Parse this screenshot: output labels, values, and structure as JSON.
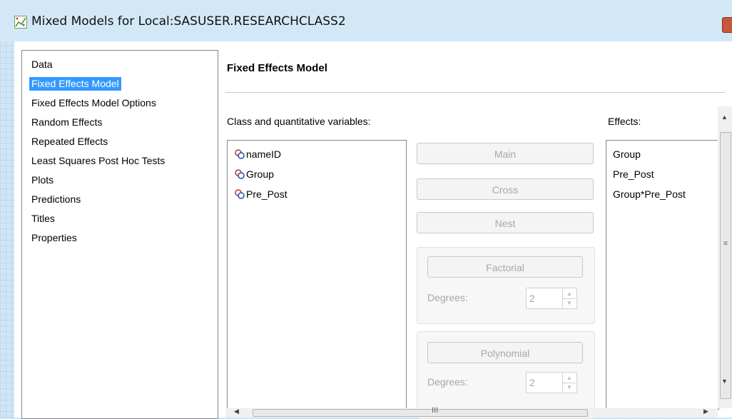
{
  "window": {
    "title": "Mixed Models for Local:SASUSER.RESEARCHCLASS2",
    "icon": "mixed-models-app-icon",
    "close_color": "#c8583d"
  },
  "nav": {
    "selected_index": 1,
    "items": [
      {
        "label": "Data"
      },
      {
        "label": "Fixed Effects Model"
      },
      {
        "label": "Fixed Effects Model Options"
      },
      {
        "label": "Random Effects"
      },
      {
        "label": "Repeated Effects"
      },
      {
        "label": "Least Squares Post Hoc Tests"
      },
      {
        "label": "Plots"
      },
      {
        "label": "Predictions"
      },
      {
        "label": "Titles"
      },
      {
        "label": "Properties"
      }
    ]
  },
  "panel": {
    "title": "Fixed Effects Model",
    "variables_label": "Class and quantitative variables:",
    "effects_label": "Effects:",
    "variables": [
      {
        "name": "nameID",
        "icon": "class-variable-icon"
      },
      {
        "name": "Group",
        "icon": "class-variable-icon"
      },
      {
        "name": "Pre_Post",
        "icon": "class-variable-icon"
      }
    ],
    "effects": [
      "Group",
      "Pre_Post",
      "Group*Pre_Post"
    ],
    "buttons": {
      "main": "Main",
      "cross": "Cross",
      "nest": "Nest",
      "factorial": "Factorial",
      "polynomial": "Polynomial"
    },
    "factorial_degrees_label": "Degrees:",
    "factorial_degrees_value": "2",
    "polynomial_degrees_label": "Degrees:",
    "polynomial_degrees_value": "2"
  },
  "scrollbars": {
    "horizontal_grip": "III",
    "vertical_grip": "≡"
  },
  "colors": {
    "selection": "#3399ff",
    "disabled_text": "#a8a8a8"
  }
}
